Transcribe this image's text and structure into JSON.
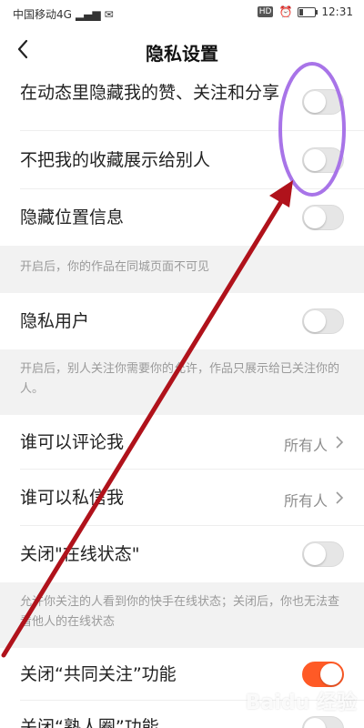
{
  "status_bar": {
    "carrier": "中国移动4G",
    "time": "12:31",
    "hd_label": "HD"
  },
  "header": {
    "title": "隐私设置"
  },
  "settings": {
    "hide_likes": {
      "label": "在动态里隐藏我的赞、关注和分享",
      "on": false
    },
    "hide_favorites": {
      "label": "不把我的收藏展示给别人",
      "on": false
    },
    "hide_location": {
      "label": "隐藏位置信息",
      "on": false
    },
    "location_note": "开启后，你的作品在同城页面不可见",
    "private_user": {
      "label": "隐私用户",
      "on": false
    },
    "private_note": "开启后，别人关注你需要你的允许，作品只展示给已关注你的人。",
    "who_comment": {
      "label": "谁可以评论我",
      "value": "所有人"
    },
    "who_message": {
      "label": "谁可以私信我",
      "value": "所有人"
    },
    "close_online": {
      "label": "关闭\"在线状态\"",
      "on": false
    },
    "online_note": "允许你关注的人看到你的快手在线状态；关闭后，你也无法查看他人的在线状态",
    "close_mutual": {
      "label": "关闭“共同关注”功能",
      "on": true
    },
    "close_acquaintance": {
      "label": "关闭“熟人圈”功能",
      "on": false
    }
  },
  "watermark": "Baidu 经验",
  "colors": {
    "accent": "#ff5a26",
    "annotation_arrow": "#b0121b",
    "annotation_circle": "#a874e8"
  }
}
